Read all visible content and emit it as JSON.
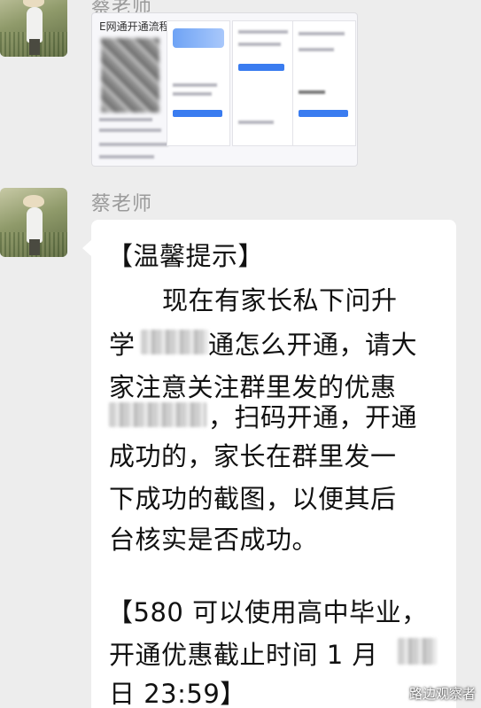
{
  "messages": [
    {
      "sender": "蔡老师",
      "type": "image",
      "image_title": "E网通开通流程"
    },
    {
      "sender": "蔡老师",
      "type": "text",
      "lines": [
        "【温馨提示】",
        "现在有家长私下问升",
        "学",
        "通怎么开通，请大",
        "家注意关注群里发的优惠",
        "，扫码开通，开通",
        "成功的，家长在群里发一",
        "下成功的截图，以便其后",
        "台核实是否成功。",
        "【580 可以使用高中毕业，",
        "开通优惠截止时间 1 月",
        "日 23:59】"
      ]
    }
  ],
  "watermark": "路边观察者"
}
